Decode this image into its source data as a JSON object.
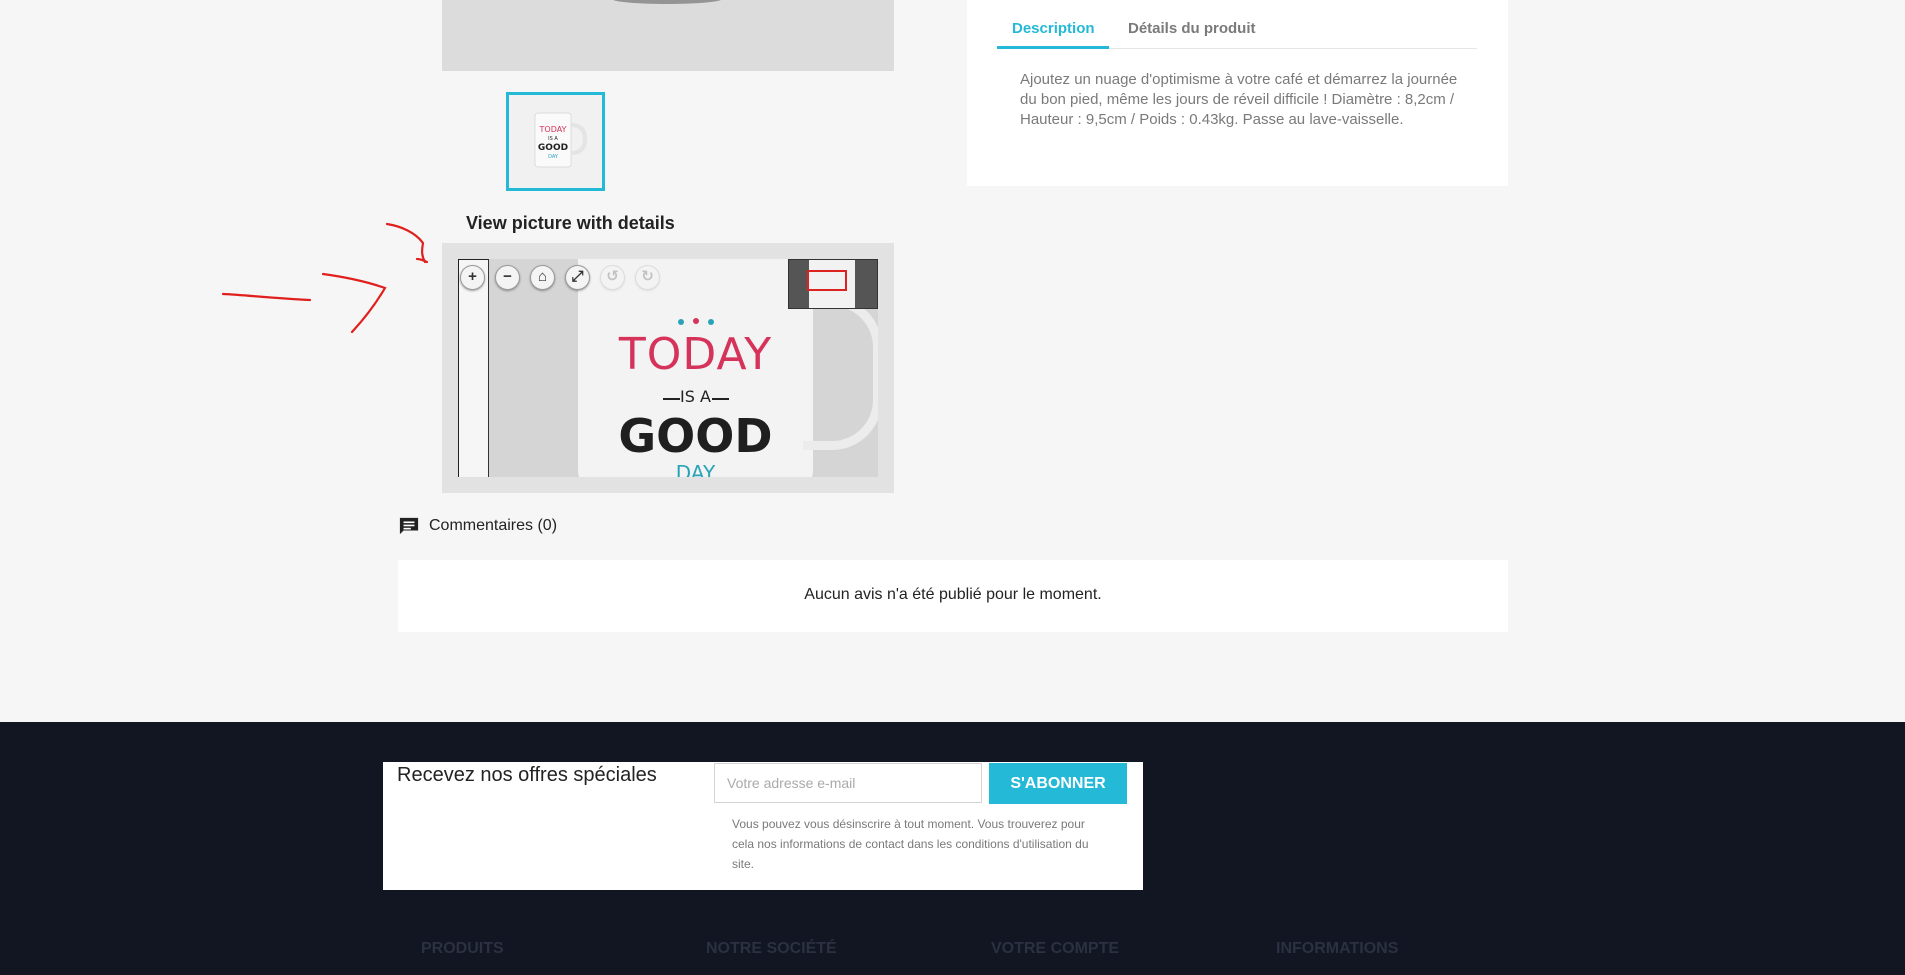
{
  "product": {
    "tabs": [
      {
        "label": "Description"
      },
      {
        "label": "Détails du produit"
      }
    ],
    "description": "Ajoutez un nuage d'optimisme à votre café et démarrez la journée du bon pied, même les jours de réveil difficile ! Diamètre : 8,2cm / Hauteur : 9,5cm / Poids : 0.43kg. Passe au lave-vaisselle."
  },
  "viewer": {
    "title": "View picture with details",
    "buttons": [
      {
        "name": "zoom-in-button",
        "icon": "plus-icon",
        "glyph": "+"
      },
      {
        "name": "zoom-out-button",
        "icon": "minus-icon",
        "glyph": "−"
      },
      {
        "name": "home-button",
        "icon": "home-icon",
        "glyph": "⌂"
      },
      {
        "name": "fullscreen-button",
        "icon": "fullscreen-icon",
        "glyph": "⤢"
      },
      {
        "name": "rotate-left-button",
        "icon": "rotate-left-icon",
        "glyph": "↺"
      },
      {
        "name": "rotate-right-button",
        "icon": "rotate-right-icon",
        "glyph": "↻"
      }
    ],
    "mug_text": {
      "line1": "TODAY",
      "line2": "IS A",
      "line3": "GOOD",
      "line4": "DAY"
    },
    "thumb_text": {
      "line1": "TODAY",
      "line2": "IS A",
      "line3": "GOOD",
      "line4": "DAY"
    }
  },
  "comments": {
    "heading": "Commentaires (0)",
    "empty_message": "Aucun avis n'a été publié pour le moment."
  },
  "newsletter": {
    "title": "Recevez nos offres spéciales",
    "email_placeholder": "Votre adresse e-mail",
    "subscribe_label": "S'ABONNER",
    "note": "Vous pouvez vous désinscrire à tout moment. Vous trouverez pour cela nos informations de contact dans les conditions d'utilisation du site."
  },
  "footer": {
    "columns": [
      "PRODUITS",
      "NOTRE SOCIÉTÉ",
      "VOTRE COMPTE",
      "INFORMATIONS"
    ]
  },
  "colors": {
    "accent": "#24b9d7",
    "footer_bg": "#111622",
    "annotation": "#e0201c"
  }
}
